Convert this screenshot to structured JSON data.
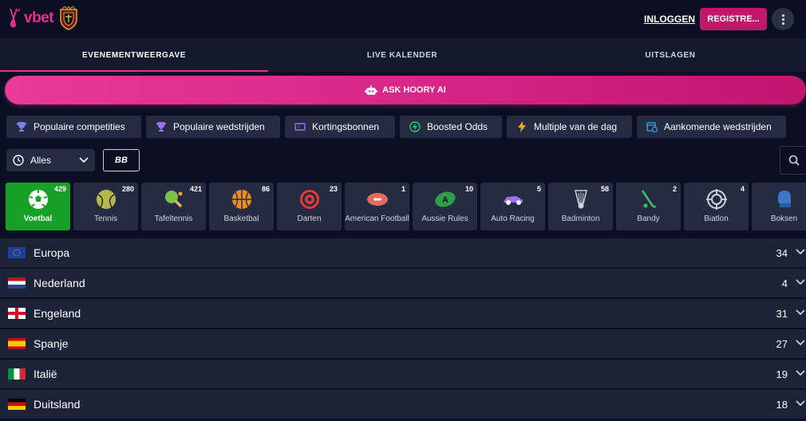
{
  "brand": {
    "name": "vbet",
    "accent": "#e8308c"
  },
  "header": {
    "login_label": "INLOGGEN",
    "register_label": "REGISTRE...",
    "more_icon": "kebab-menu-icon"
  },
  "tabs": [
    {
      "label": "EVENEMENTWEERGAVE",
      "active": true
    },
    {
      "label": "LIVE KALENDER",
      "active": false
    },
    {
      "label": "UITSLAGEN",
      "active": false
    }
  ],
  "hoory": {
    "label": "ASK HOORY AI",
    "icon": "robot-icon"
  },
  "quick_links": [
    {
      "label": "Populaire competities",
      "icon": "trophy-icon"
    },
    {
      "label": "Populaire wedstrijden",
      "icon": "trophy-icon"
    },
    {
      "label": "Kortingsbonnen",
      "icon": "ticket-icon"
    },
    {
      "label": "Boosted Odds",
      "icon": "boost-icon"
    },
    {
      "label": "Multiple van de dag",
      "icon": "lightning-icon"
    },
    {
      "label": "Aankomende wedstrijden",
      "icon": "calendar-clock-icon"
    }
  ],
  "filter": {
    "label": "Alles",
    "icon": "clock-icon",
    "bb_label": "BB"
  },
  "sports": [
    {
      "name": "Voetbal",
      "count": "429",
      "active": true,
      "icon": "football-icon"
    },
    {
      "name": "Tennis",
      "count": "280",
      "active": false,
      "icon": "tennis-icon"
    },
    {
      "name": "Tafeltennis",
      "count": "421",
      "active": false,
      "icon": "table-tennis-icon"
    },
    {
      "name": "Basketbal",
      "count": "86",
      "active": false,
      "icon": "basketball-icon"
    },
    {
      "name": "Darten",
      "count": "23",
      "active": false,
      "icon": "darts-icon"
    },
    {
      "name": "American Football",
      "count": "1",
      "active": false,
      "icon": "american-football-icon"
    },
    {
      "name": "Aussie Rules",
      "count": "10",
      "active": false,
      "icon": "aussie-rules-icon"
    },
    {
      "name": "Auto Racing",
      "count": "5",
      "active": false,
      "icon": "auto-racing-icon"
    },
    {
      "name": "Badminton",
      "count": "58",
      "active": false,
      "icon": "badminton-icon"
    },
    {
      "name": "Bandy",
      "count": "2",
      "active": false,
      "icon": "bandy-icon"
    },
    {
      "name": "Biatlon",
      "count": "4",
      "active": false,
      "icon": "biathlon-icon"
    },
    {
      "name": "Boksen",
      "count": "",
      "active": false,
      "icon": "boxing-icon"
    }
  ],
  "countries": [
    {
      "name": "Europa",
      "count": "34",
      "flag": "eu"
    },
    {
      "name": "Nederland",
      "count": "4",
      "flag": "nl"
    },
    {
      "name": "Engeland",
      "count": "31",
      "flag": "en"
    },
    {
      "name": "Spanje",
      "count": "27",
      "flag": "es"
    },
    {
      "name": "Italië",
      "count": "19",
      "flag": "it"
    },
    {
      "name": "Duitsland",
      "count": "18",
      "flag": "de"
    }
  ]
}
